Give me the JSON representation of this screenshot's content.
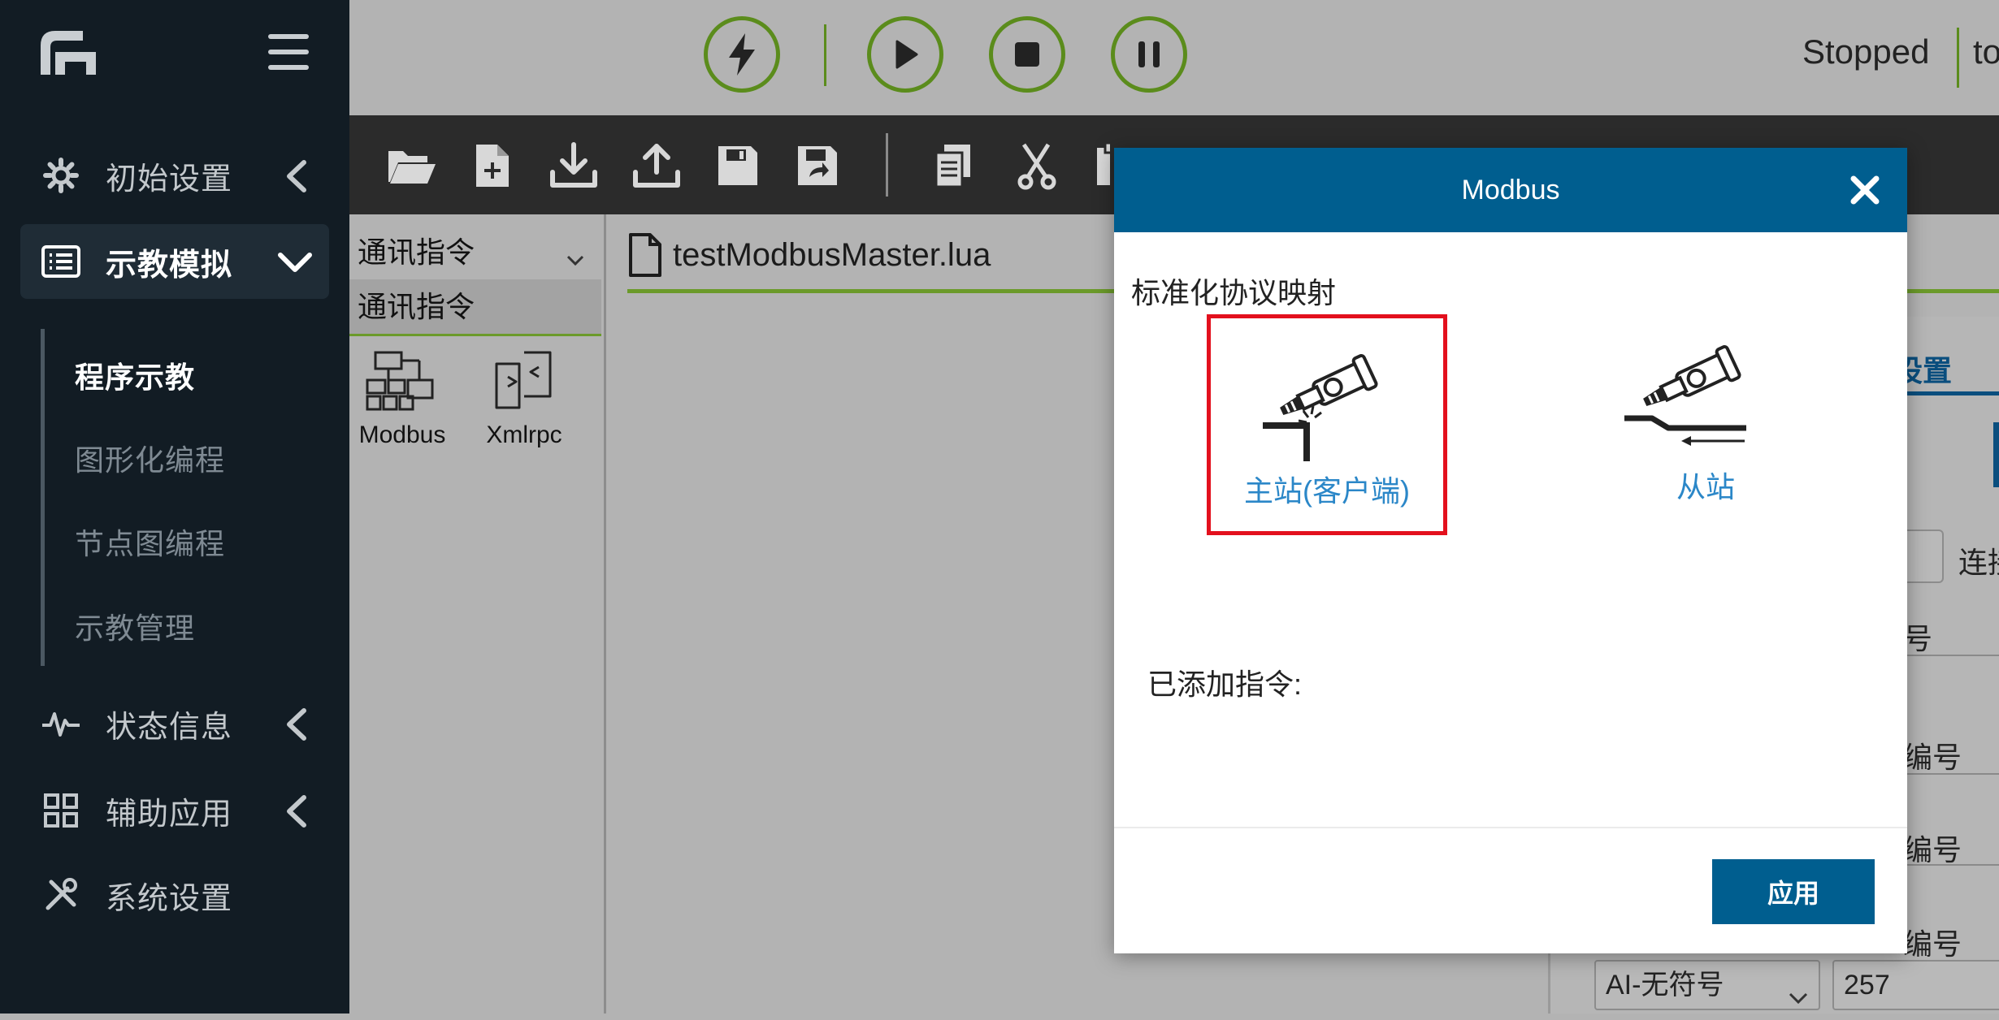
{
  "colors": {
    "sidebar_bg": "#121c24",
    "accent_green": "#5b8c1c",
    "modal_header": "#005e8f",
    "selection_red": "#e3101d",
    "link_blue": "#2b87c8"
  },
  "sidebar": {
    "logo_icon": "robot-logo-icon",
    "menu_icon": "hamburger-menu-icon",
    "items": [
      {
        "label": "初始设置",
        "icon": "gear-icon"
      },
      {
        "label": "示教模拟",
        "icon": "list-icon"
      },
      {
        "label": "状态信息",
        "icon": "pulse-icon"
      },
      {
        "label": "辅助应用",
        "icon": "grid-icon"
      },
      {
        "label": "系统设置",
        "icon": "tools-icon"
      }
    ],
    "subitems": [
      {
        "label": "程序示教"
      },
      {
        "label": "图形化编程"
      },
      {
        "label": "节点图编程"
      },
      {
        "label": "示教管理"
      }
    ]
  },
  "controls": {
    "buttons": [
      "enable-lightning-icon",
      "play-icon",
      "stop-icon",
      "pause-icon"
    ],
    "status": "Stopped",
    "status_extra": "to"
  },
  "toolbar": {
    "icons": [
      "open-folder-icon",
      "new-file-icon",
      "download-icon",
      "upload-icon",
      "save-icon",
      "save-as-icon",
      "copy-icon",
      "cut-icon",
      "paste-icon"
    ]
  },
  "command_panel": {
    "select_value": "通讯指令",
    "category": "通讯指令",
    "tiles": [
      {
        "label": "Modbus",
        "icon": "modbus-icon"
      },
      {
        "label": "Xmlrpc",
        "icon": "xmlrpc-icon"
      }
    ]
  },
  "editor": {
    "file_name": "testModbusMaster.lua"
  },
  "right_panel": {
    "tab_label": "设置",
    "labels": [
      "连接",
      "号",
      "编号",
      "编号",
      "编号"
    ],
    "select_value": "AI-无符号",
    "value": "257"
  },
  "modal": {
    "title": "Modbus",
    "subtitle": "标准化协议映射",
    "options": [
      {
        "label": "主站(客户端)",
        "selected": true
      },
      {
        "label": "从站",
        "selected": false
      }
    ],
    "added_label": "已添加指令:",
    "apply_label": "应用"
  }
}
